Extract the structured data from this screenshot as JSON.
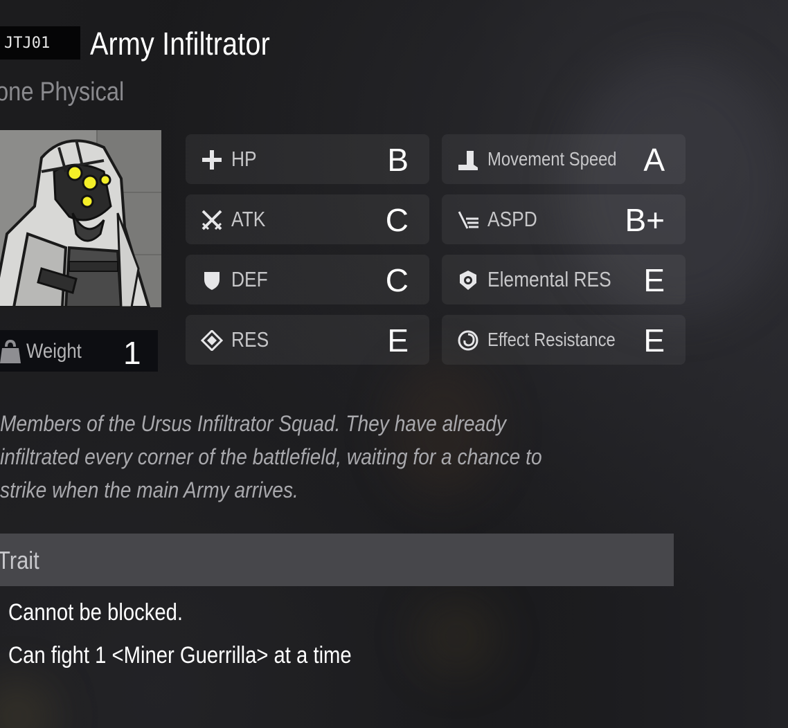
{
  "enemy": {
    "code": "JTJ01",
    "name": "Army Infiltrator",
    "damage_type": "one Physical"
  },
  "portrait": {
    "icon": "hooded-infiltrator-portrait"
  },
  "weight": {
    "label": "Weight",
    "value": "1",
    "icon": "weight-icon"
  },
  "stats": {
    "hp": {
      "label": "HP",
      "grade": "B",
      "icon": "plus-icon"
    },
    "atk": {
      "label": "ATK",
      "grade": "C",
      "icon": "crossed-swords-icon"
    },
    "def": {
      "label": "DEF",
      "grade": "C",
      "icon": "shield-icon"
    },
    "res": {
      "label": "RES",
      "grade": "E",
      "icon": "diamond-icon"
    },
    "movement_speed": {
      "label": "Movement Speed",
      "grade": "A",
      "icon": "boot-icon"
    },
    "aspd": {
      "label": "ASPD",
      "grade": "B+",
      "icon": "attack-speed-icon"
    },
    "elemental_res": {
      "label": "Elemental RES",
      "grade": "E",
      "icon": "elemental-shield-icon"
    },
    "effect_resistance": {
      "label": "Effect Resistance",
      "grade": "E",
      "icon": "spiral-icon"
    }
  },
  "description": {
    "line1": "Members of the Ursus Infiltrator Squad. They have already",
    "line2": "infiltrated every corner of the battlefield, waiting for a chance to",
    "line3": "strike when the main Army arrives."
  },
  "trait": {
    "title": "Trait",
    "line1": "Cannot be blocked.",
    "line2": "Can fight 1 <Miner Guerrilla> at a time"
  },
  "colors": {
    "background": "#161618",
    "card": "#2a2a2c",
    "trait_header": "#47474b",
    "muted_text": "#a9a9ad"
  }
}
